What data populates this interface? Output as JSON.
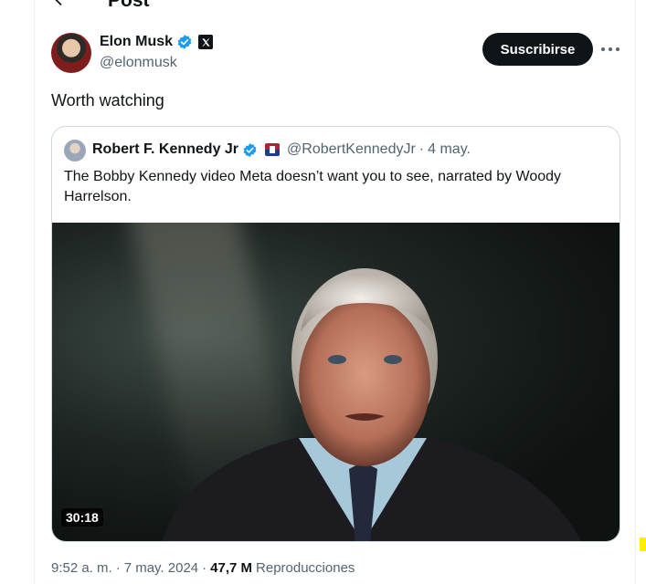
{
  "header": {
    "title": "Post"
  },
  "post": {
    "author_name": "Elon Musk",
    "author_handle": "@elonmusk",
    "subscribe_label": "Suscribirse",
    "text": "Worth watching",
    "time": "9:52 a. m.",
    "separator": "·",
    "date": "7 may. 2024",
    "views_count": "47,7 M",
    "views_label": "Reproducciones"
  },
  "quote": {
    "author_name": "Robert F. Kennedy Jr",
    "author_handle": "@RobertKennedyJr",
    "separator": "·",
    "date": "4 may.",
    "text": "The Bobby Kennedy video Meta doesn’t want you to see, narrated by Woody Harrelson.",
    "video_duration": "30:18"
  },
  "colors": {
    "accent": "#1d9bf0",
    "text_primary": "#0f1419",
    "text_secondary": "#536471",
    "button_bg": "#0f1419"
  },
  "icons": {
    "back": "arrow-left-icon",
    "verified": "verified-badge-icon",
    "affiliate": "x-logo-icon",
    "more": "more-horizontal-icon",
    "flag": "us-flag-icon"
  }
}
